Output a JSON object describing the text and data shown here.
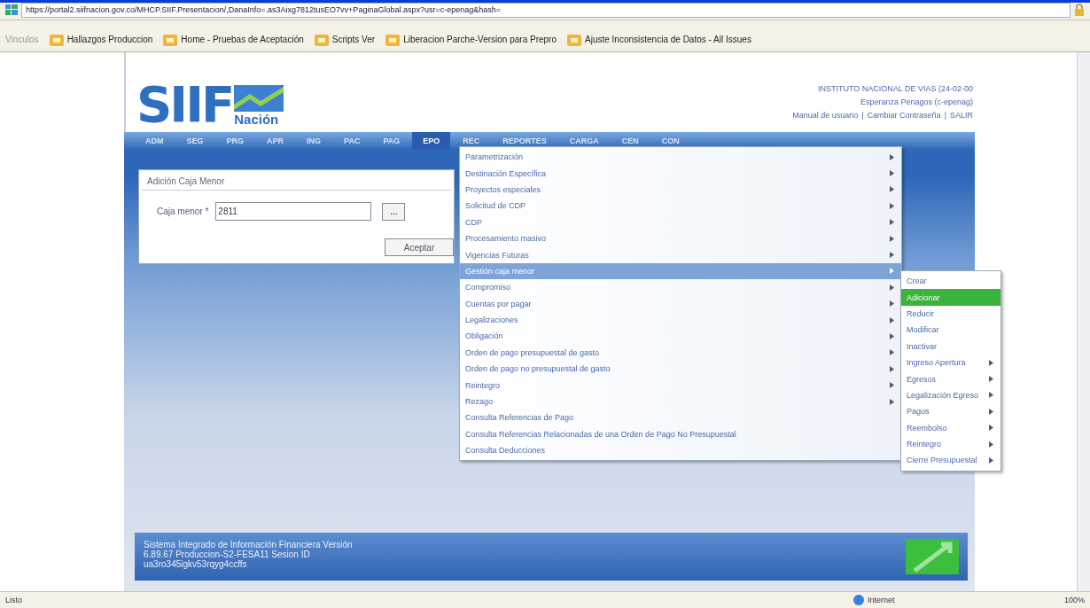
{
  "browser": {
    "url": "https://portal2.siifnacion.gov.co/MHCP.SIIF.Presentacion/,DanaInfo=.as3Aixg7812tusEO7vv+PaginaGlobal.aspx?usr=c-epenag&hash=",
    "links_label": "Vinculos",
    "bookmarks": [
      "Hallazgos Produccion",
      "Home - Pruebas de Aceptación",
      "Scripts Ver",
      "Liberacion Parche-Version para Prepro",
      "Ajuste Inconsistencia de Datos - All Issues"
    ]
  },
  "header": {
    "logo": "SIIF",
    "logo_sub": "Nación",
    "organization": "INSTITUTO NACIONAL DE VIAS (24-02-00",
    "user": "Esperanza Penagos (c-epenag)",
    "links": [
      "Manual de usuario",
      "Cambiar Contraseña",
      "SALIR"
    ],
    "separator": "|"
  },
  "nav": [
    {
      "label": "ADM",
      "selected": false
    },
    {
      "label": "SEG",
      "selected": false
    },
    {
      "label": "PRG",
      "selected": false
    },
    {
      "label": "APR",
      "selected": false
    },
    {
      "label": "ING",
      "selected": false
    },
    {
      "label": "PAC",
      "selected": false
    },
    {
      "label": "PAG",
      "selected": false
    },
    {
      "label": "EPO",
      "selected": true
    },
    {
      "label": "REC",
      "selected": false
    },
    {
      "label": "REPORTES",
      "selected": false
    },
    {
      "label": "CARGA",
      "selected": false
    },
    {
      "label": "CEN",
      "selected": false
    },
    {
      "label": "CON",
      "selected": false
    }
  ],
  "form": {
    "title": "Adición Caja Menor",
    "field_label": "Caja menor *",
    "field_value": "2811",
    "lookup": "...",
    "submit": "Aceptar"
  },
  "menu": [
    {
      "label": "Parametrización",
      "submenu": true,
      "selected": false
    },
    {
      "label": "Destinación Específica",
      "submenu": true,
      "selected": false
    },
    {
      "label": "Proyectos especiales",
      "submenu": true,
      "selected": false
    },
    {
      "label": "Solicitud de CDP",
      "submenu": true,
      "selected": false
    },
    {
      "label": "CDP",
      "submenu": true,
      "selected": false
    },
    {
      "label": "Procesamiento masivo",
      "submenu": true,
      "selected": false
    },
    {
      "label": "Vigencias Futuras",
      "submenu": true,
      "selected": false
    },
    {
      "label": "Gestión caja menor",
      "submenu": true,
      "selected": true
    },
    {
      "label": "Compromiso",
      "submenu": true,
      "selected": false
    },
    {
      "label": "Cuentas por pagar",
      "submenu": true,
      "selected": false
    },
    {
      "label": "Legalizaciones",
      "submenu": true,
      "selected": false
    },
    {
      "label": "Obligación",
      "submenu": true,
      "selected": false
    },
    {
      "label": "Orden de pago presupuestal de gasto",
      "submenu": true,
      "selected": false
    },
    {
      "label": "Orden de pago no presupuestal de gasto",
      "submenu": true,
      "selected": false
    },
    {
      "label": "Reintegro",
      "submenu": true,
      "selected": false
    },
    {
      "label": "Rezago",
      "submenu": true,
      "selected": false
    },
    {
      "label": "Consulta Referencias de Pago",
      "submenu": false,
      "selected": false
    },
    {
      "label": "Consulta Referencias Relacionadas de una Orden de Pago No Presupuestal",
      "submenu": false,
      "selected": false
    },
    {
      "label": "Consulta Deducciones",
      "submenu": false,
      "selected": false
    }
  ],
  "submenu": [
    {
      "label": "Crear",
      "submenu": false,
      "selected": false
    },
    {
      "label": "Adicionar",
      "submenu": false,
      "selected": true
    },
    {
      "label": "Reducir",
      "submenu": false,
      "selected": false
    },
    {
      "label": "Modificar",
      "submenu": false,
      "selected": false
    },
    {
      "label": "Inactivar",
      "submenu": false,
      "selected": false
    },
    {
      "label": "Ingreso Apertura",
      "submenu": true,
      "selected": false
    },
    {
      "label": "Egresos",
      "submenu": true,
      "selected": false
    },
    {
      "label": "Legalización Egreso",
      "submenu": true,
      "selected": false
    },
    {
      "label": "Pagos",
      "submenu": true,
      "selected": false
    },
    {
      "label": "Reembolso",
      "submenu": true,
      "selected": false
    },
    {
      "label": "Reintegro",
      "submenu": true,
      "selected": false
    },
    {
      "label": "Cierre Presupuestal",
      "submenu": true,
      "selected": false
    }
  ],
  "footer": [
    "Sistema Integrado de Información Financiera Versión",
    "6.89.67 Produccion-S2-FESA11 Sesion ID",
    "ua3ro345igkv53rqyg4ccffs"
  ],
  "status_bar": {
    "text": "Listo",
    "zone": "Internet",
    "zoom": "100%"
  }
}
